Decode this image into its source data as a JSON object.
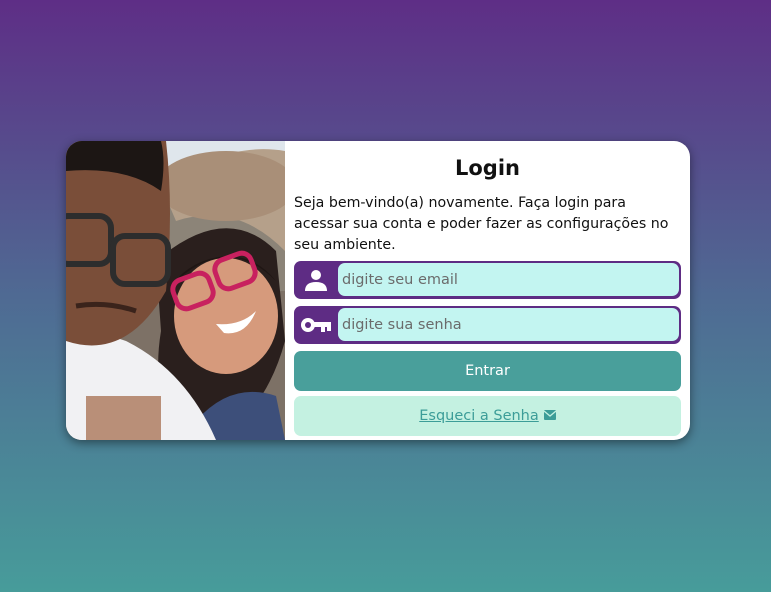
{
  "login": {
    "title": "Login",
    "welcome_text": "Seja bem-vindo(a) novamente. Faça login para acessar sua conta e poder fazer as configurações no seu ambiente.",
    "email_placeholder": "digite seu email",
    "password_placeholder": "digite sua senha",
    "submit_label": "Entrar",
    "forgot_label": "Esqueci a Senha"
  },
  "icons": {
    "email_field": "user-icon",
    "password_field": "key-icon",
    "forgot_link": "mail-icon"
  },
  "colors": {
    "primary_purple": "#5e2c84",
    "teal_button": "#499f9b",
    "input_background": "#c3f5f1",
    "forgot_background": "#c4f1e1",
    "link_color": "#3c9d98"
  }
}
